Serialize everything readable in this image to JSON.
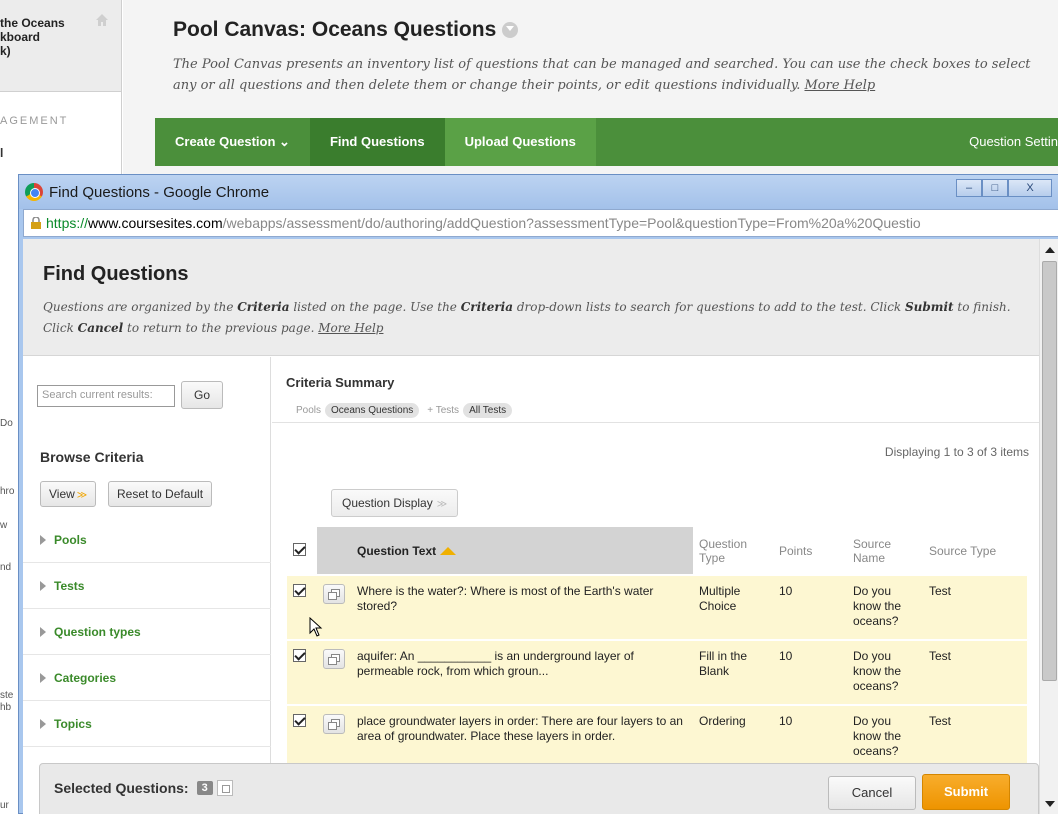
{
  "background": {
    "course_lines": [
      "the Oceans",
      "kboard",
      "k)"
    ],
    "management_label": "AGEMENT",
    "management_item": "l",
    "left_fragments": [
      "Do",
      "hro",
      "w",
      "nd",
      "ste",
      "hb",
      "ur"
    ],
    "page_title": "Pool Canvas: Oceans Questions",
    "page_description": "The Pool Canvas presents an inventory list of questions that can be managed and searched. You can use the check boxes to select any or all questions and then delete them or change their points, or edit questions individually.",
    "more_help": "More Help",
    "toolbar": {
      "create": "Create Question",
      "find": "Find Questions",
      "upload": "Upload Questions",
      "settings": "Question Settin"
    }
  },
  "window": {
    "title": "Find Questions - Google Chrome",
    "min": "–",
    "max": "□",
    "close": "X",
    "url_scheme": "https://",
    "url_host": "www.coursesites.com",
    "url_path": "/webapps/assessment/do/authoring/addQuestion?assessmentType=Pool&questionType=From%20a%20Questio"
  },
  "find_questions": {
    "title": "Find Questions",
    "description_parts": {
      "p1": "Questions are organized by the ",
      "b1": "Criteria",
      "p2": " listed on the page. Use the ",
      "b2": "Criteria",
      "p3": " drop-down lists to search for questions to add to the test. Click ",
      "b3": "Submit",
      "p4": " to finish. Click ",
      "b4": "Cancel",
      "p5": " to return to the previous page. "
    },
    "more_help": "More Help"
  },
  "left_panel": {
    "search_placeholder": "Search current results:",
    "go_label": "Go",
    "browse_title": "Browse Criteria",
    "view_label": "View",
    "reset_label": "Reset to Default",
    "criteria": [
      "Pools",
      "Tests",
      "Question types",
      "Categories",
      "Topics"
    ]
  },
  "criteria_summary": {
    "title": "Criteria Summary",
    "pools_label": "Pools",
    "pools_value": "Oceans Questions",
    "tests_label": "+ Tests",
    "tests_value": "All Tests"
  },
  "results": {
    "displaying": "Displaying 1 to 3 of 3 items",
    "question_display": "Question Display",
    "headers": {
      "question_text": "Question Text",
      "question_type": "Question Type",
      "points": "Points",
      "source_name": "Source Name",
      "source_type": "Source Type"
    },
    "rows": [
      {
        "text": "Where is the water?: Where is most of the Earth's water stored?",
        "type": "Multiple Choice",
        "points": "10",
        "source_name": "Do you know the oceans?",
        "source_type": "Test"
      },
      {
        "text": "aquifer: An ___________ is an underground layer of permeable rock, from which groun...",
        "type": "Fill in the Blank",
        "points": "10",
        "source_name": "Do you know the oceans?",
        "source_type": "Test"
      },
      {
        "text": "place groundwater layers in order: There are four layers to an area of groundwater. Place these layers in order.",
        "type": "Ordering",
        "points": "10",
        "source_name": "Do you know the oceans?",
        "source_type": "Test"
      }
    ]
  },
  "footer": {
    "selected_label": "Selected Questions:",
    "selected_count": "3",
    "cancel": "Cancel",
    "submit": "Submit"
  }
}
